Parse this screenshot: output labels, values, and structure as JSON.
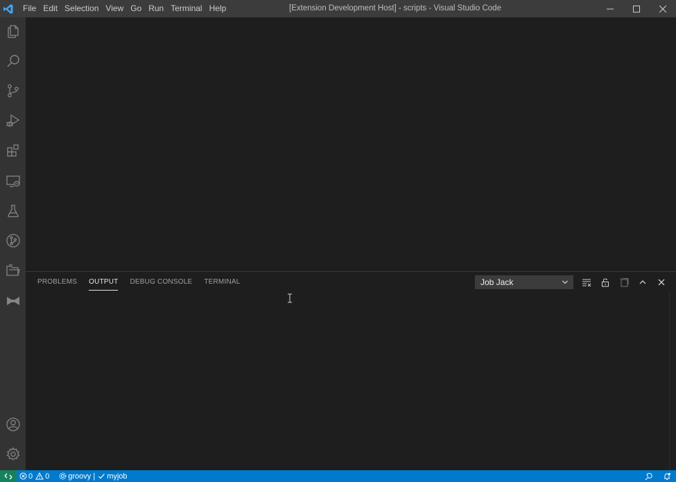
{
  "window": {
    "title": "[Extension Development Host] - scripts - Visual Studio Code"
  },
  "menu": [
    "File",
    "Edit",
    "Selection",
    "View",
    "Go",
    "Run",
    "Terminal",
    "Help"
  ],
  "activity_bar": {
    "items": [
      "files-icon",
      "search-icon",
      "source-control-icon",
      "run-debug-icon",
      "extensions-icon",
      "remote-explorer-icon",
      "testing-icon",
      "git-graph-icon",
      "folder-icon",
      "bowtie-icon"
    ],
    "bottom": [
      "account-icon",
      "gear-icon"
    ]
  },
  "panel": {
    "tabs": [
      "PROBLEMS",
      "OUTPUT",
      "DEBUG CONSOLE",
      "TERMINAL"
    ],
    "active_tab": "OUTPUT",
    "output_channel": "Job Jack"
  },
  "status_bar": {
    "errors": "0",
    "warnings": "0",
    "language": "groovy |",
    "job": "myjob"
  },
  "colors": {
    "status_bar": "#007acc",
    "remote": "#16825d",
    "activity_bar": "#333333",
    "title_bar": "#3c3c3c",
    "editor": "#1e1e1e"
  }
}
